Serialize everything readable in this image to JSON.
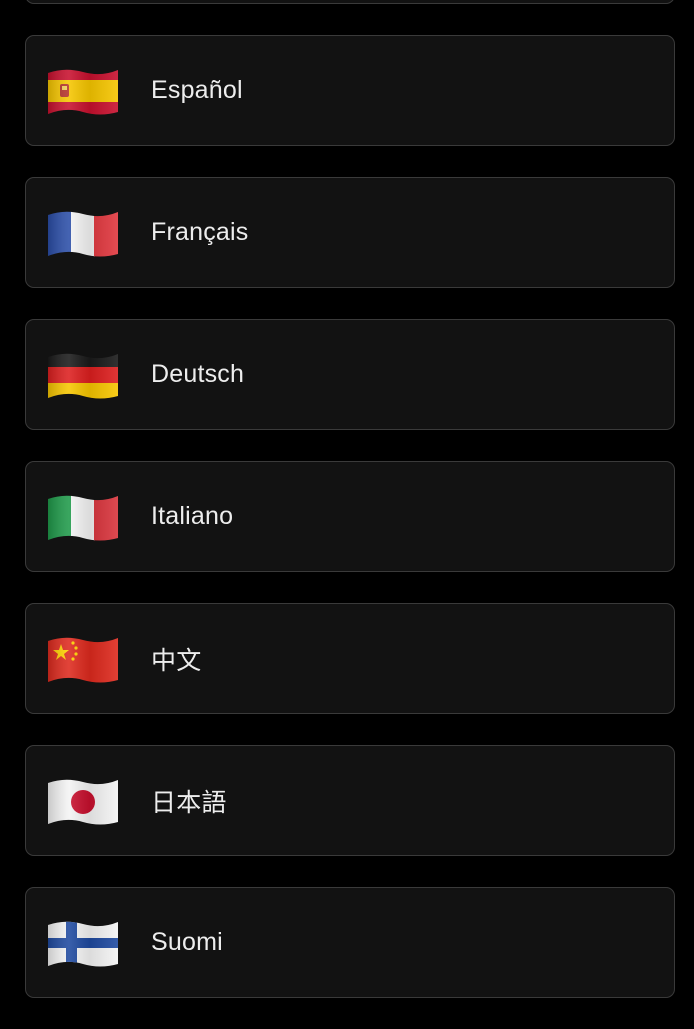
{
  "language_list": {
    "items": [
      {
        "label": "",
        "flag_icon": "flag-partial-icon"
      },
      {
        "label": "Español",
        "flag_icon": "flag-spain-icon"
      },
      {
        "label": "Français",
        "flag_icon": "flag-france-icon"
      },
      {
        "label": "Deutsch",
        "flag_icon": "flag-germany-icon"
      },
      {
        "label": "Italiano",
        "flag_icon": "flag-italy-icon"
      },
      {
        "label": "中文",
        "flag_icon": "flag-china-icon"
      },
      {
        "label": "日本語",
        "flag_icon": "flag-japan-icon"
      },
      {
        "label": "Suomi",
        "flag_icon": "flag-finland-icon"
      }
    ]
  },
  "colors": {
    "background": "#000000",
    "item_background": "#121212",
    "item_border": "#3a3a3a",
    "text": "#ededed"
  }
}
